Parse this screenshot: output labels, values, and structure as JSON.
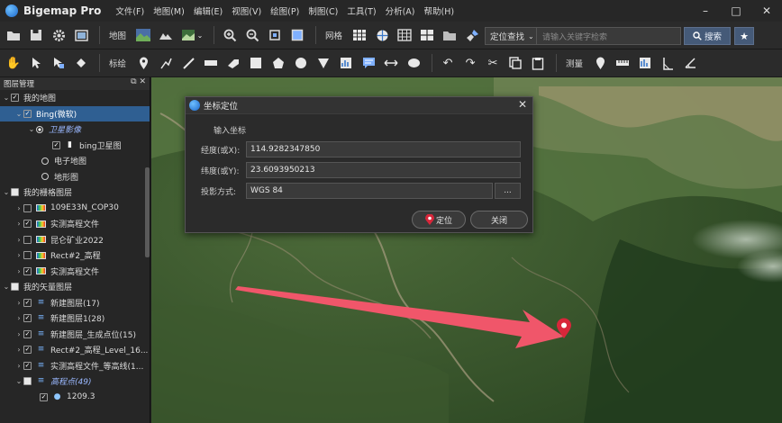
{
  "app": {
    "name": "Bigemap Pro",
    "menus": [
      "文件(F)",
      "地图(M)",
      "编辑(E)",
      "视图(V)",
      "绘图(P)",
      "制图(C)",
      "工具(T)",
      "分析(A)",
      "帮助(H)"
    ]
  },
  "toolbar1": {
    "map_label": "地图",
    "grid_label": "网格",
    "search_mode": "定位查找",
    "search_placeholder": "请输入关键字检索",
    "search_button": "搜索"
  },
  "toolbar2": {
    "label_tool": "标绘",
    "measure_tool": "测量"
  },
  "layer_panel": {
    "title": "图层管理",
    "rows": [
      {
        "label": "我的地图"
      },
      {
        "label": "Bing(微软)"
      },
      {
        "label": "卫星影像"
      },
      {
        "label": "bing卫星图"
      },
      {
        "label": "电子地图"
      },
      {
        "label": "地形图"
      },
      {
        "label": "我的栅格图层"
      },
      {
        "label": "109E33N_COP30"
      },
      {
        "label": "实测高程文件"
      },
      {
        "label": "昆仑矿业2022"
      },
      {
        "label": "Rect#2_高程"
      },
      {
        "label": "实测高程文件"
      },
      {
        "label": "我的矢量图层"
      },
      {
        "label": "新建图层(17)"
      },
      {
        "label": "新建图层1(28)"
      },
      {
        "label": "新建图层_生成点位(15)"
      },
      {
        "label": "Rect#2_高程_Level_16..."
      },
      {
        "label": "实测高程文件_等高线(1..."
      },
      {
        "label": "高程点(49)"
      },
      {
        "label": "1209.3"
      }
    ]
  },
  "dialog": {
    "title": "坐标定位",
    "section": "输入坐标",
    "longitude_label": "经度(或X):",
    "longitude_value": "114.9282347850",
    "latitude_label": "纬度(或Y):",
    "latitude_value": "23.6093950213",
    "projection_label": "投影方式:",
    "projection_value": "WGS 84",
    "more_button": "...",
    "locate_button": "定位",
    "close_button": "关闭"
  },
  "colors": {
    "selection": "#2f5f92",
    "accent_button": "#455a78",
    "marker_red": "#d8263a",
    "arrow_red": "#f0566a"
  }
}
